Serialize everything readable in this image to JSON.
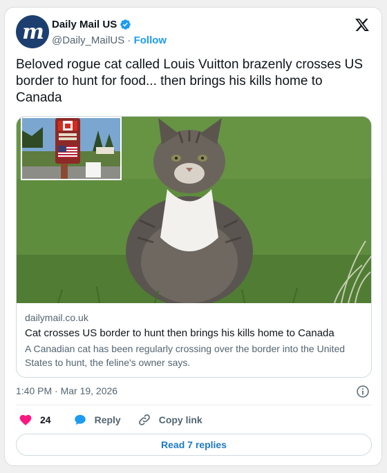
{
  "account": {
    "name": "Daily Mail US",
    "handle": "@Daily_MailUS",
    "separator": "·",
    "follow_label": "Follow",
    "avatar_letter": "m",
    "avatar_color": "#1d3f70",
    "verified_icon": "verified-badge-icon"
  },
  "tweet": {
    "text": "Beloved rogue cat called Louis Vuitton brazenly crosses US border to hunt for food... then brings his kills home to Canada"
  },
  "link_card": {
    "domain": "dailymail.co.uk",
    "title": "Cat crosses US border to hunt then brings his kills home to Canada",
    "description": "A Canadian cat has been regularly crossing over the border into the United States to hunt, the feline's owner says."
  },
  "timestamp": "1:40 PM · Mar 19, 2026",
  "actions": {
    "like_count": "24",
    "reply_label": "Reply",
    "copy_link_label": "Copy link"
  },
  "read_replies_label": "Read 7 replies",
  "colors": {
    "accent": "#1d9bf0",
    "like": "#f91880",
    "text_secondary": "#536471"
  }
}
